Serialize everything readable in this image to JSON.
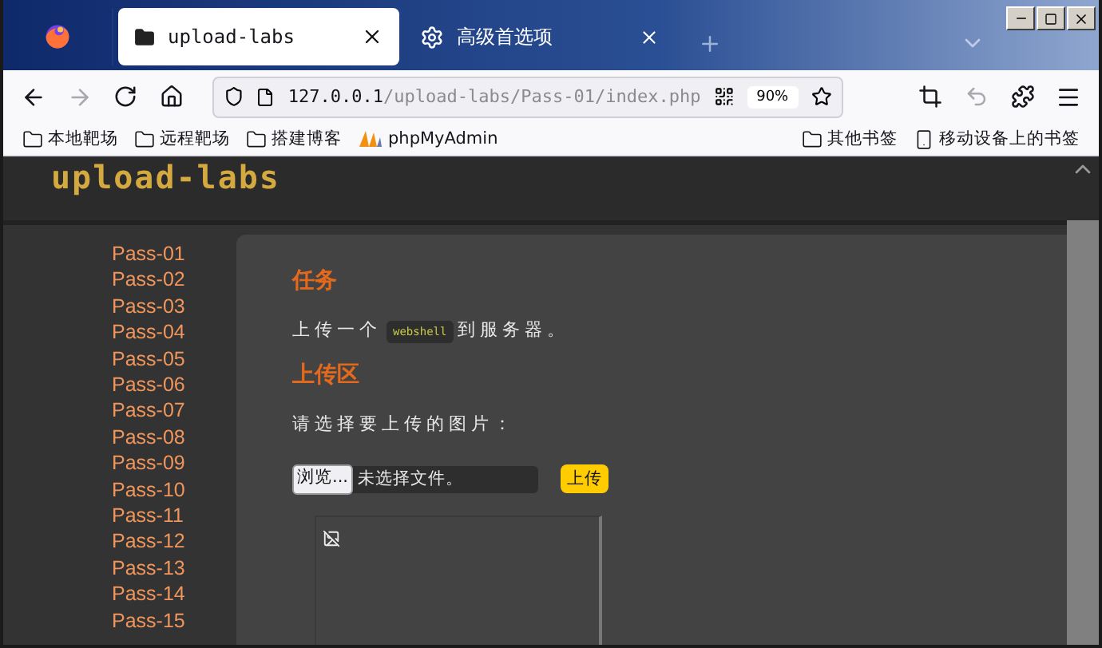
{
  "tabs": [
    {
      "kind": "app"
    },
    {
      "kind": "page",
      "title": "upload-labs",
      "selected": true
    },
    {
      "kind": "settings",
      "title": "高级首选项",
      "selected": false
    }
  ],
  "nav": {
    "forward_disabled": true,
    "undo_disabled": true
  },
  "url": {
    "host": "127.0.0.1",
    "path": "/upload-labs/Pass-01/index.php",
    "zoom": "90%"
  },
  "bookmarks": [
    {
      "kind": "folder",
      "label": "本地靶场"
    },
    {
      "kind": "folder",
      "label": "远程靶场"
    },
    {
      "kind": "folder",
      "label": "搭建博客"
    },
    {
      "kind": "pma",
      "label": "phpMyAdmin"
    }
  ],
  "bookmarks_right": [
    {
      "kind": "folder",
      "label": "其他书签"
    },
    {
      "kind": "mobile",
      "label": "移动设备上的书签"
    }
  ],
  "page": {
    "logo": "upload-labs",
    "sidebar": [
      "Pass-01",
      "Pass-02",
      "Pass-03",
      "Pass-04",
      "Pass-05",
      "Pass-06",
      "Pass-07",
      "Pass-08",
      "Pass-09",
      "Pass-10",
      "Pass-11",
      "Pass-12",
      "Pass-13",
      "Pass-14",
      "Pass-15"
    ],
    "task_heading": "任务",
    "task": {
      "before": "上传一个",
      "code": "webshell",
      "after": "到服务器。"
    },
    "upload_heading": "上传区",
    "prompt": "请选择要上传的图片：",
    "file_button": "浏览...",
    "file_status": "未选择文件。",
    "submit": "上传"
  }
}
